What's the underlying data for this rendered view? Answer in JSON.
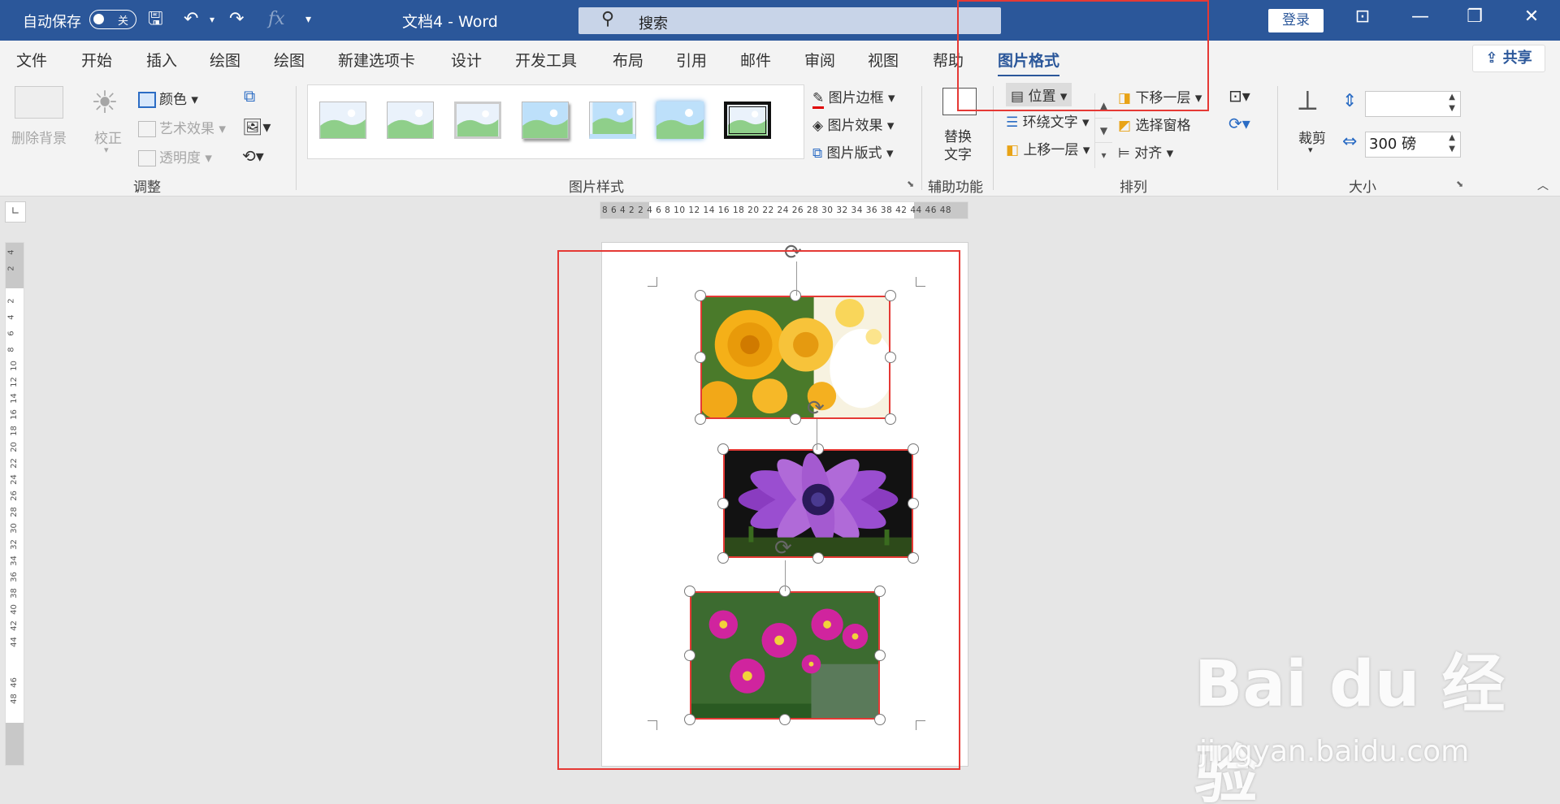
{
  "titlebar": {
    "autosave": "自动保存",
    "toggle_state": "关",
    "doc_title": "文档4  -  Word",
    "search_placeholder": "搜索",
    "login": "登录"
  },
  "menu": [
    "文件",
    "开始",
    "插入",
    "绘图",
    "绘图",
    "新建选项卡",
    "设计",
    "开发工具",
    "布局",
    "引用",
    "邮件",
    "审阅",
    "视图",
    "帮助",
    "图片格式"
  ],
  "share": "共享",
  "ribbon": {
    "adjust": {
      "remove_bg": "删除背景",
      "correct": "校正",
      "color": "颜色",
      "art_effects": "艺术效果",
      "transparency": "透明度",
      "label": "调整"
    },
    "styles": {
      "border": "图片边框",
      "effects": "图片效果",
      "layout": "图片版式",
      "label": "图片样式"
    },
    "accessibility": {
      "alt_text_line1": "替换",
      "alt_text_line2": "文字",
      "label": "辅助功能"
    },
    "arrange": {
      "position": "位置",
      "wrap_text": "环绕文字",
      "bring_forward": "上移一层",
      "send_backward": "下移一层",
      "selection_pane": "选择窗格",
      "align": "对齐",
      "label": "排列"
    },
    "size": {
      "crop": "裁剪",
      "height_value": "",
      "width_value": "300 磅",
      "label": "大小"
    }
  },
  "ruler": {
    "h_numbers": "8  6  4  2    2  4  6  8 10 12 14 16 18 20 22 24 26 28 30 32 34 36 38   42 44 46 48",
    "v_numbers": [
      "4",
      "2",
      "2",
      "4",
      "6",
      "8",
      "10",
      "12",
      "14",
      "16",
      "18",
      "20",
      "22",
      "24",
      "26",
      "28",
      "30",
      "32",
      "34",
      "36",
      "38",
      "40",
      "42",
      "44",
      "46",
      "48"
    ]
  },
  "images": [
    {
      "name": "yellow-roses",
      "colors": [
        "#f5b018",
        "#e08a00",
        "#3f7d2b",
        "#ffffff"
      ]
    },
    {
      "name": "purple-daisy",
      "colors": [
        "#7a2fb0",
        "#b06ad8",
        "#1a1a1a",
        "#3a6b1f"
      ]
    },
    {
      "name": "pink-cosmos",
      "colors": [
        "#c5168f",
        "#e84bbf",
        "#2f6b2b",
        "#4a8a3b"
      ]
    }
  ],
  "watermark": {
    "brand": "Bai du 经验",
    "url": "jingyan.baidu.com"
  }
}
